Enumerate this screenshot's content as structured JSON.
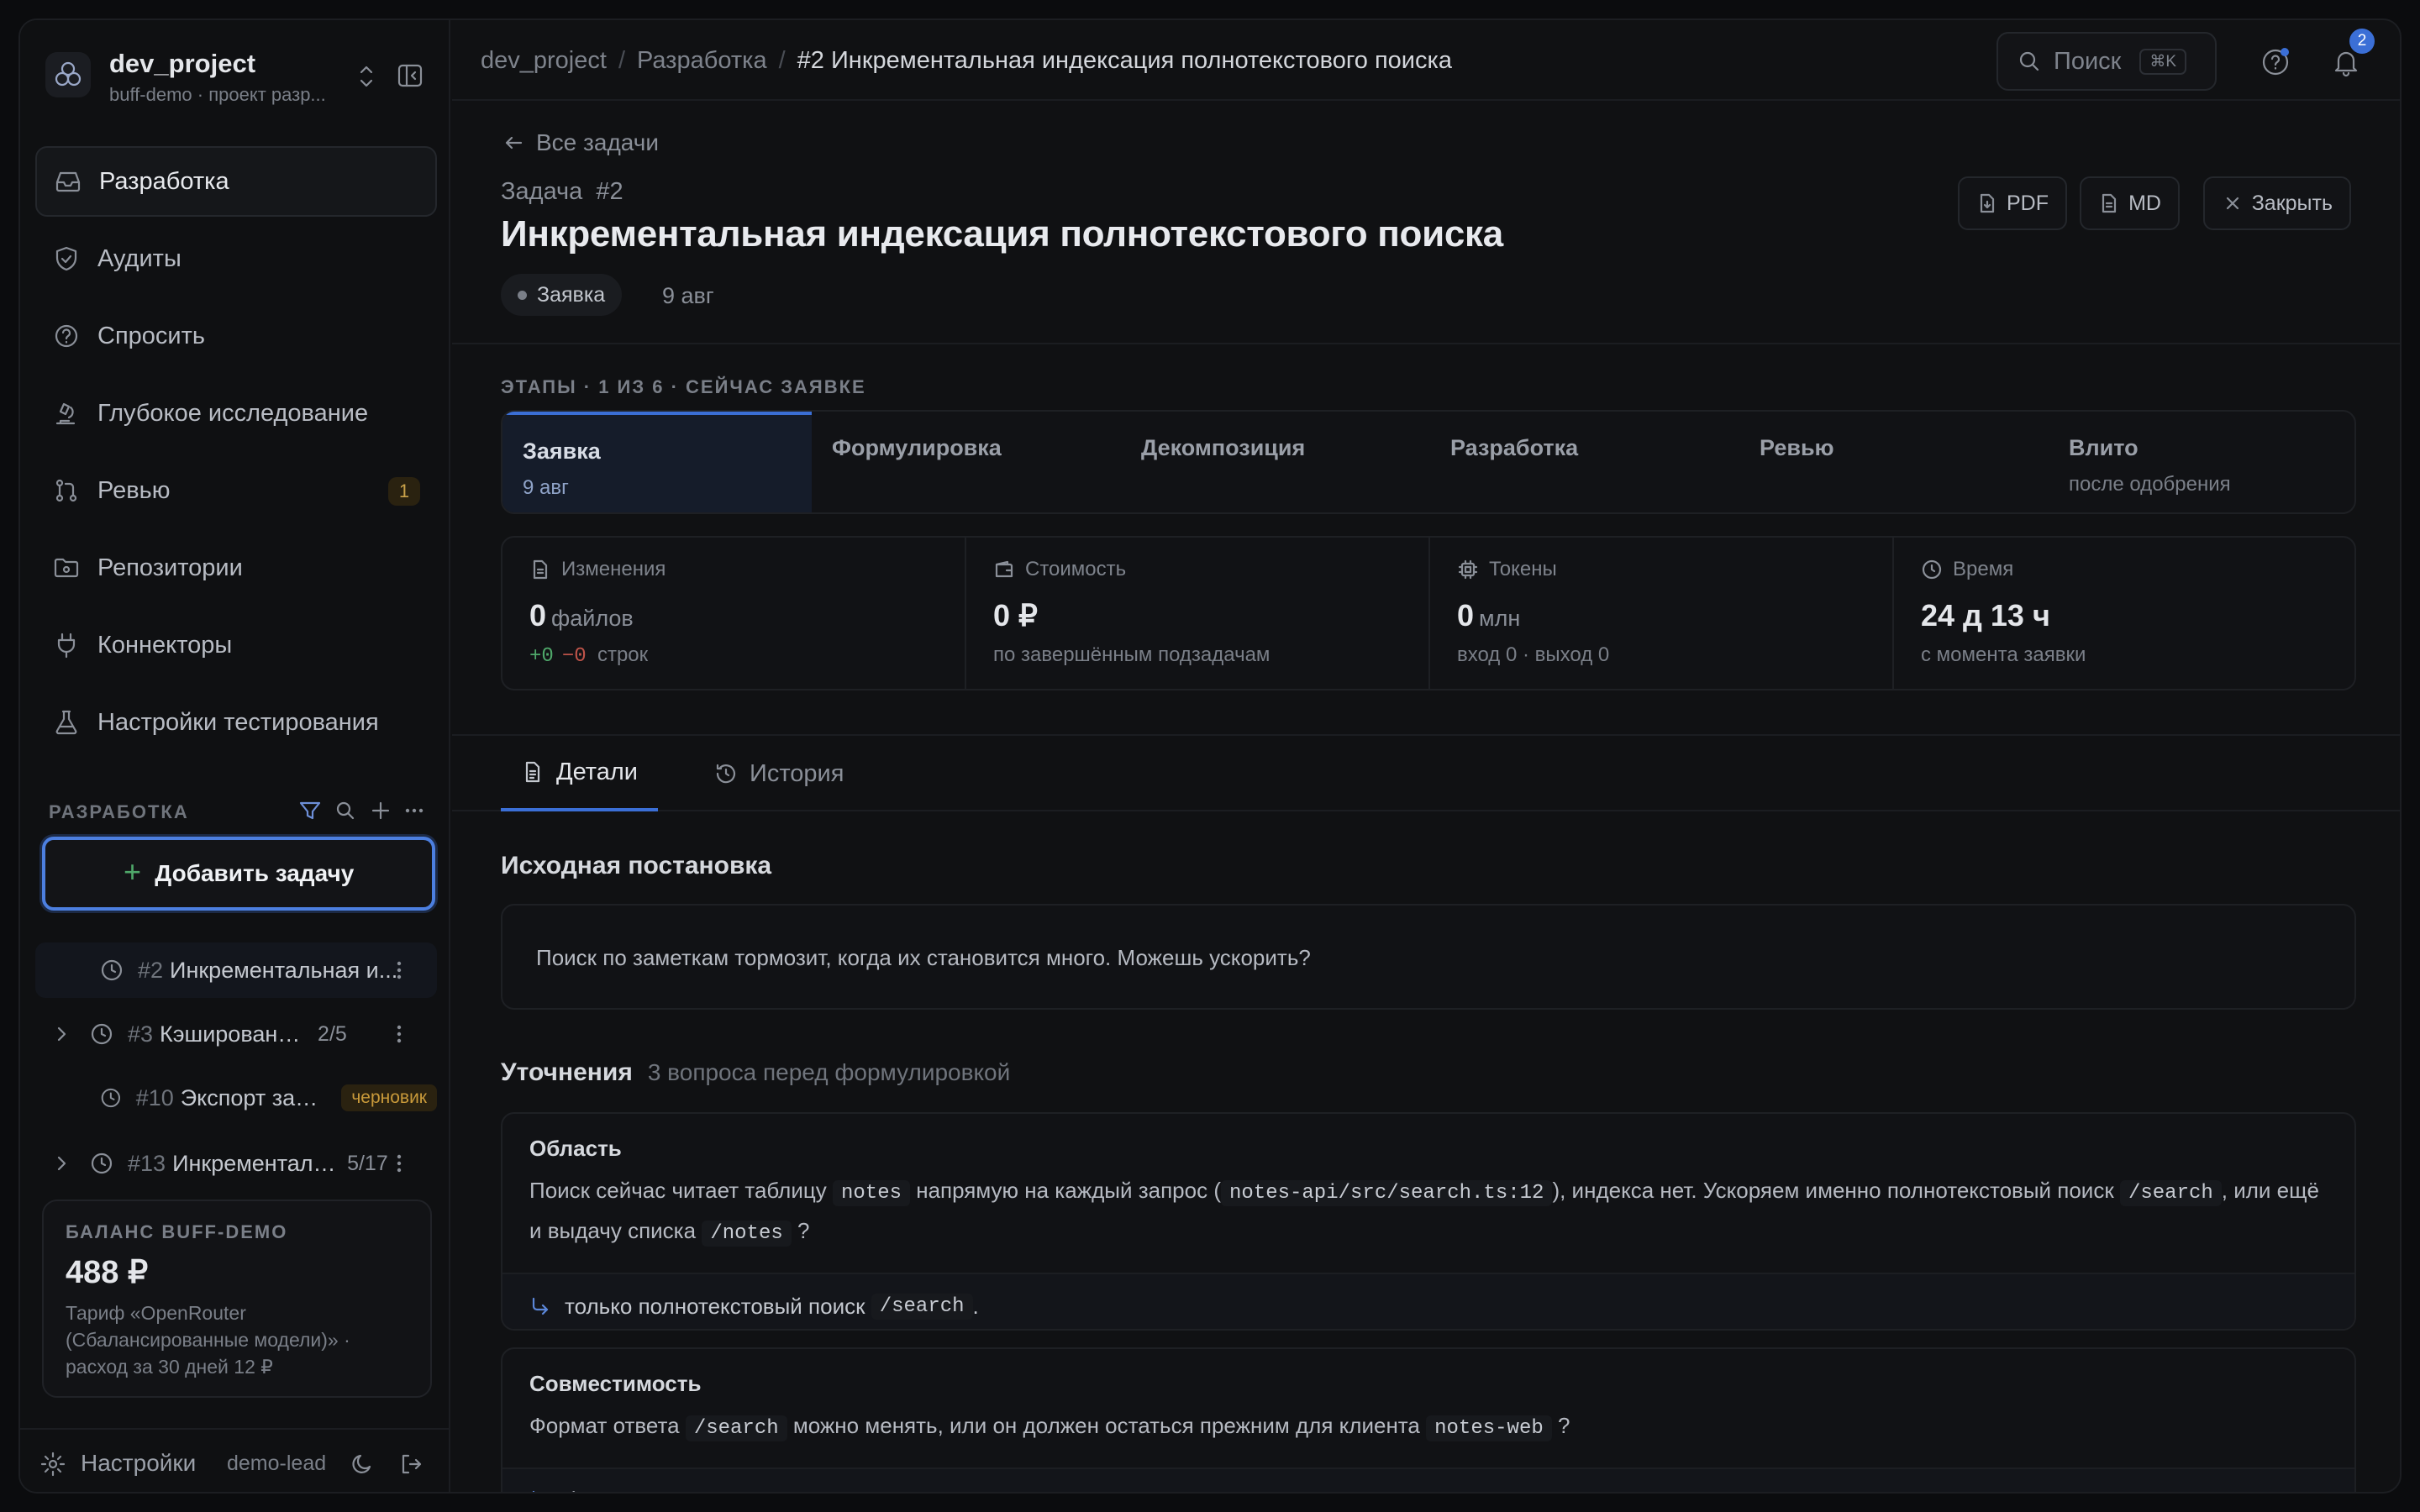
{
  "project": {
    "name": "dev_project",
    "subtitle": "buff-demo · проект разр..."
  },
  "nav": [
    {
      "label": "Разработка",
      "icon": "inbox-icon",
      "active": true
    },
    {
      "label": "Аудиты",
      "icon": "shield-icon"
    },
    {
      "label": "Спросить",
      "icon": "help-circle-icon"
    },
    {
      "label": "Глубокое исследование",
      "icon": "microscope-icon"
    },
    {
      "label": "Ревью",
      "icon": "git-pull-request-icon",
      "badge": "1"
    },
    {
      "label": "Репозитории",
      "icon": "folder-git-icon"
    },
    {
      "label": "Коннекторы",
      "icon": "plug-icon"
    },
    {
      "label": "Настройки тестирования",
      "icon": "flask-icon"
    }
  ],
  "section": {
    "label": "РАЗРАБОТКА",
    "add_task": "Добавить задачу"
  },
  "tasks": [
    {
      "num": "#2",
      "title": "Инкрементальная и...",
      "count": "",
      "chip": "",
      "expand": false,
      "active": true
    },
    {
      "num": "#3",
      "title": "Кэширование от...",
      "count": "2/5",
      "chip": "",
      "expand": true
    },
    {
      "num": "#10",
      "title": "Экспорт заме...",
      "count": "",
      "chip": "черновик",
      "expand": false
    },
    {
      "num": "#13",
      "title": "Инкременталь...",
      "count": "5/17",
      "chip": "",
      "expand": true
    }
  ],
  "balance": {
    "label": "БАЛАНС BUFF-DEMO",
    "value": "488 ₽",
    "line1": "Тариф «OpenRouter",
    "line2": "(Сбалансированные модели)» ·",
    "line3": "расход за 30 дней 12 ₽"
  },
  "footer": {
    "settings": "Настройки",
    "user": "demo-lead"
  },
  "breadcrumb": {
    "c1": "dev_project",
    "c2": "Разработка",
    "c3": "#2 Инкрементальная индексация полнотекстового поиска"
  },
  "search": {
    "label": "Поиск",
    "kbd": "⌘K"
  },
  "notifications": {
    "count": "2"
  },
  "header": {
    "back": "Все задачи",
    "task_label": "Задача",
    "task_num": "#2",
    "title": "Инкрементальная индексация полнотекстового поиска",
    "status": "Заявка",
    "date": "9 авг",
    "btn_pdf": "PDF",
    "btn_md": "MD",
    "btn_close": "Закрыть"
  },
  "stages": {
    "label": "ЭТАПЫ · 1 ИЗ 6 · СЕЙЧАС ЗАЯВКЕ",
    "items": [
      {
        "name": "Заявка",
        "sub": "9 авг",
        "active": true
      },
      {
        "name": "Формулировка",
        "sub": ""
      },
      {
        "name": "Декомпозиция",
        "sub": ""
      },
      {
        "name": "Разработка",
        "sub": ""
      },
      {
        "name": "Ревью",
        "sub": ""
      },
      {
        "name": "Влито",
        "sub": "после одобрения"
      }
    ]
  },
  "metrics": [
    {
      "label": "Изменения",
      "value": "0",
      "unit": "файлов",
      "sub_plus": "+0",
      "sub_minus": "−0",
      "sub": "строк",
      "icon": "file-icon"
    },
    {
      "label": "Стоимость",
      "value": "0 ₽",
      "unit": "",
      "sub": "по завершённым подзадачам",
      "icon": "wallet-icon"
    },
    {
      "label": "Токены",
      "value": "0",
      "unit": "млн",
      "sub": "вход 0 · выход 0",
      "icon": "cpu-icon"
    },
    {
      "label": "Время",
      "value": "24 д 13 ч",
      "unit": "",
      "sub": "с момента заявки",
      "icon": "clock-icon"
    }
  ],
  "tabs": {
    "details": "Детали",
    "history": "История"
  },
  "original": {
    "title": "Исходная постановка",
    "text": "Поиск по заметкам тормозит, когда их становится много. Можешь ускорить?"
  },
  "clarifications": {
    "title": "Уточнения",
    "subtitle": "3 вопроса перед формулировкой",
    "q1": {
      "title": "Область",
      "t1": "Поиск сейчас читает таблицу",
      "c1": "notes",
      "t2": "напрямую на каждый запрос (",
      "c2": "notes-api/src/search.ts:12",
      "t3": "), индекса нет. Ускоряем именно полнотекстовый поиск",
      "c3": "/search",
      "t4": ", или ещё и выдачу списка",
      "c4": "/notes",
      "t5": "?",
      "a1": "только полнотекстовый поиск",
      "ac": "/search",
      "a2": "."
    },
    "q2": {
      "title": "Совместимость",
      "t1": "Формат ответа",
      "c1": "/search",
      "t2": "можно менять, или он должен остаться прежним для клиента",
      "c2": "notes-web",
      "t3": "?",
      "answer": "формат ответа не менять — клиент не трогаем."
    }
  },
  "colors": {
    "accent": "#3b6fd6",
    "focus": "#4c7fe0",
    "badge_bg": "#2a2210",
    "badge_fg": "#c9a24a",
    "plus": "#4fa86a",
    "minus": "#c0544a"
  }
}
